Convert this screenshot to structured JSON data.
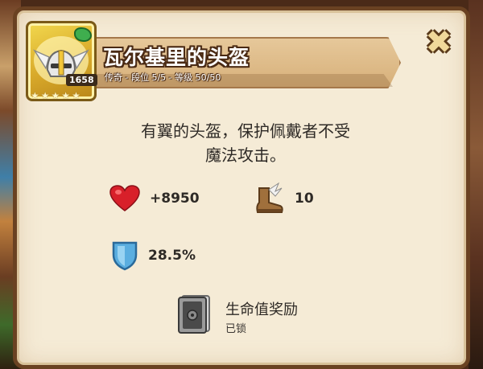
{
  "item": {
    "name": "瓦尔基里的头盔",
    "subtitle": "传奇 - 段位 5/5 - 等级 50/50",
    "power": "1658",
    "stars": 5,
    "icon": "winged-helmet-icon"
  },
  "description": {
    "line1": "有翼的头盔，保护佩戴者不受",
    "line2": "魔法攻击。"
  },
  "stats": {
    "health": {
      "icon": "heart-icon",
      "value": "+8950"
    },
    "speed": {
      "icon": "winged-boot-icon",
      "value": "10"
    },
    "defense": {
      "icon": "shield-icon",
      "value": "28.5%"
    }
  },
  "bonus": {
    "icon": "locked-safe-icon",
    "name": "生命值奖励",
    "status": "已锁"
  },
  "close": {
    "icon": "close-icon"
  },
  "colors": {
    "panel": "#f5ebd6",
    "border": "#6a4222",
    "ribbon": "#d7b07a",
    "frame_gold": "#d8a92a",
    "heart": "#d8202a",
    "shield": "#5aaee0"
  }
}
